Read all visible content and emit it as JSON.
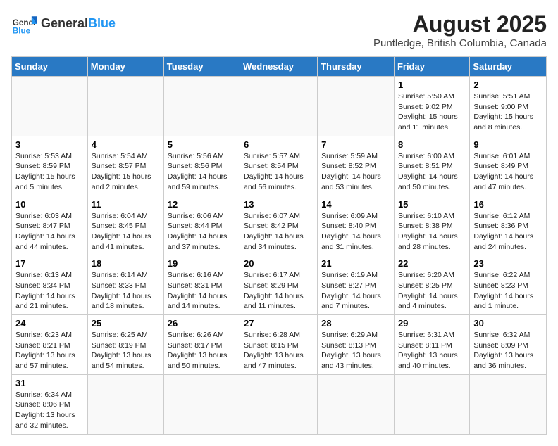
{
  "logo": {
    "text_general": "General",
    "text_blue": "Blue"
  },
  "header": {
    "title": "August 2025",
    "subtitle": "Puntledge, British Columbia, Canada"
  },
  "columns": [
    "Sunday",
    "Monday",
    "Tuesday",
    "Wednesday",
    "Thursday",
    "Friday",
    "Saturday"
  ],
  "weeks": [
    [
      {
        "day": "",
        "info": ""
      },
      {
        "day": "",
        "info": ""
      },
      {
        "day": "",
        "info": ""
      },
      {
        "day": "",
        "info": ""
      },
      {
        "day": "",
        "info": ""
      },
      {
        "day": "1",
        "info": "Sunrise: 5:50 AM\nSunset: 9:02 PM\nDaylight: 15 hours and 11 minutes."
      },
      {
        "day": "2",
        "info": "Sunrise: 5:51 AM\nSunset: 9:00 PM\nDaylight: 15 hours and 8 minutes."
      }
    ],
    [
      {
        "day": "3",
        "info": "Sunrise: 5:53 AM\nSunset: 8:59 PM\nDaylight: 15 hours and 5 minutes."
      },
      {
        "day": "4",
        "info": "Sunrise: 5:54 AM\nSunset: 8:57 PM\nDaylight: 15 hours and 2 minutes."
      },
      {
        "day": "5",
        "info": "Sunrise: 5:56 AM\nSunset: 8:56 PM\nDaylight: 14 hours and 59 minutes."
      },
      {
        "day": "6",
        "info": "Sunrise: 5:57 AM\nSunset: 8:54 PM\nDaylight: 14 hours and 56 minutes."
      },
      {
        "day": "7",
        "info": "Sunrise: 5:59 AM\nSunset: 8:52 PM\nDaylight: 14 hours and 53 minutes."
      },
      {
        "day": "8",
        "info": "Sunrise: 6:00 AM\nSunset: 8:51 PM\nDaylight: 14 hours and 50 minutes."
      },
      {
        "day": "9",
        "info": "Sunrise: 6:01 AM\nSunset: 8:49 PM\nDaylight: 14 hours and 47 minutes."
      }
    ],
    [
      {
        "day": "10",
        "info": "Sunrise: 6:03 AM\nSunset: 8:47 PM\nDaylight: 14 hours and 44 minutes."
      },
      {
        "day": "11",
        "info": "Sunrise: 6:04 AM\nSunset: 8:45 PM\nDaylight: 14 hours and 41 minutes."
      },
      {
        "day": "12",
        "info": "Sunrise: 6:06 AM\nSunset: 8:44 PM\nDaylight: 14 hours and 37 minutes."
      },
      {
        "day": "13",
        "info": "Sunrise: 6:07 AM\nSunset: 8:42 PM\nDaylight: 14 hours and 34 minutes."
      },
      {
        "day": "14",
        "info": "Sunrise: 6:09 AM\nSunset: 8:40 PM\nDaylight: 14 hours and 31 minutes."
      },
      {
        "day": "15",
        "info": "Sunrise: 6:10 AM\nSunset: 8:38 PM\nDaylight: 14 hours and 28 minutes."
      },
      {
        "day": "16",
        "info": "Sunrise: 6:12 AM\nSunset: 8:36 PM\nDaylight: 14 hours and 24 minutes."
      }
    ],
    [
      {
        "day": "17",
        "info": "Sunrise: 6:13 AM\nSunset: 8:34 PM\nDaylight: 14 hours and 21 minutes."
      },
      {
        "day": "18",
        "info": "Sunrise: 6:14 AM\nSunset: 8:33 PM\nDaylight: 14 hours and 18 minutes."
      },
      {
        "day": "19",
        "info": "Sunrise: 6:16 AM\nSunset: 8:31 PM\nDaylight: 14 hours and 14 minutes."
      },
      {
        "day": "20",
        "info": "Sunrise: 6:17 AM\nSunset: 8:29 PM\nDaylight: 14 hours and 11 minutes."
      },
      {
        "day": "21",
        "info": "Sunrise: 6:19 AM\nSunset: 8:27 PM\nDaylight: 14 hours and 7 minutes."
      },
      {
        "day": "22",
        "info": "Sunrise: 6:20 AM\nSunset: 8:25 PM\nDaylight: 14 hours and 4 minutes."
      },
      {
        "day": "23",
        "info": "Sunrise: 6:22 AM\nSunset: 8:23 PM\nDaylight: 14 hours and 1 minute."
      }
    ],
    [
      {
        "day": "24",
        "info": "Sunrise: 6:23 AM\nSunset: 8:21 PM\nDaylight: 13 hours and 57 minutes."
      },
      {
        "day": "25",
        "info": "Sunrise: 6:25 AM\nSunset: 8:19 PM\nDaylight: 13 hours and 54 minutes."
      },
      {
        "day": "26",
        "info": "Sunrise: 6:26 AM\nSunset: 8:17 PM\nDaylight: 13 hours and 50 minutes."
      },
      {
        "day": "27",
        "info": "Sunrise: 6:28 AM\nSunset: 8:15 PM\nDaylight: 13 hours and 47 minutes."
      },
      {
        "day": "28",
        "info": "Sunrise: 6:29 AM\nSunset: 8:13 PM\nDaylight: 13 hours and 43 minutes."
      },
      {
        "day": "29",
        "info": "Sunrise: 6:31 AM\nSunset: 8:11 PM\nDaylight: 13 hours and 40 minutes."
      },
      {
        "day": "30",
        "info": "Sunrise: 6:32 AM\nSunset: 8:09 PM\nDaylight: 13 hours and 36 minutes."
      }
    ],
    [
      {
        "day": "31",
        "info": "Sunrise: 6:34 AM\nSunset: 8:06 PM\nDaylight: 13 hours and 32 minutes."
      },
      {
        "day": "",
        "info": ""
      },
      {
        "day": "",
        "info": ""
      },
      {
        "day": "",
        "info": ""
      },
      {
        "day": "",
        "info": ""
      },
      {
        "day": "",
        "info": ""
      },
      {
        "day": "",
        "info": ""
      }
    ]
  ]
}
